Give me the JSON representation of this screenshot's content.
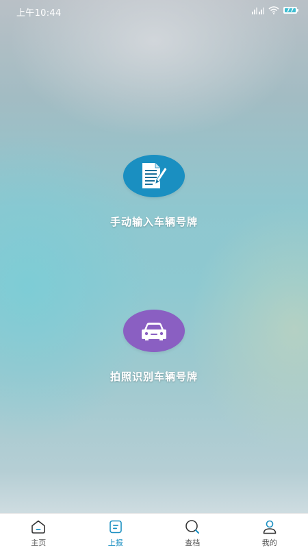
{
  "status_bar": {
    "time": "上午10:44",
    "battery": "77",
    "icons": [
      "signal-icon",
      "wifi-icon",
      "battery-icon"
    ]
  },
  "actions": [
    {
      "label": "手动输入车辆号牌",
      "icon": "document-edit-icon",
      "color": "#1a8fc1"
    },
    {
      "label": "拍照识别车辆号牌",
      "icon": "car-icon",
      "color": "#8a5fc2"
    }
  ],
  "bottom_nav": {
    "active_index": 1,
    "active_color": "#1a8fc1",
    "items": [
      {
        "label": "主页",
        "icon": "home-icon"
      },
      {
        "label": "上报",
        "icon": "report-icon"
      },
      {
        "label": "查档",
        "icon": "search-icon"
      },
      {
        "label": "我的",
        "icon": "user-icon"
      }
    ]
  }
}
